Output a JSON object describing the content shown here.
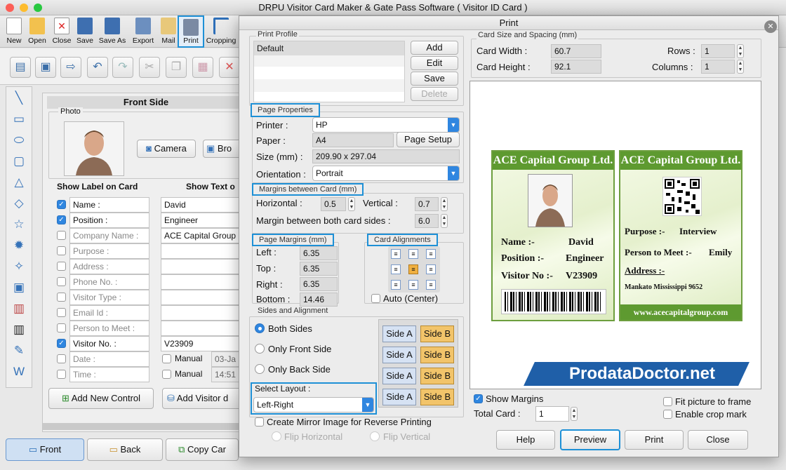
{
  "app": {
    "title": "DRPU Visitor Card Maker & Gate Pass Software ( Visitor ID Card )"
  },
  "toolbar": {
    "items": [
      "New",
      "Open",
      "Close",
      "Save",
      "Save As",
      "Export",
      "Mail",
      "Print",
      "Cropping"
    ]
  },
  "front": {
    "title": "Front Side",
    "photo_label": "Photo",
    "camera": "Camera",
    "browse": "Bro",
    "show_label": "Show Label on Card",
    "show_text": "Show Text o",
    "rows": [
      {
        "label": "Name :",
        "value": "David",
        "checked": true
      },
      {
        "label": "Position :",
        "value": "Engineer",
        "checked": true
      },
      {
        "label": "Company Name :",
        "value": "ACE Capital Group",
        "checked": false
      },
      {
        "label": "Purpose :",
        "value": "",
        "checked": false
      },
      {
        "label": "Address :",
        "value": "",
        "checked": false
      },
      {
        "label": "Phone No. :",
        "value": "",
        "checked": false
      },
      {
        "label": "Visitor Type :",
        "value": "",
        "checked": false
      },
      {
        "label": "Email Id :",
        "value": "",
        "checked": false
      },
      {
        "label": "Person to Meet :",
        "value": "",
        "checked": false
      },
      {
        "label": "Visitor No. :",
        "value": "V23909",
        "checked": true
      },
      {
        "label": "Date :",
        "value": "03-Ja",
        "checked": false,
        "manual": "Manual"
      },
      {
        "label": "Time :",
        "value": "14:51",
        "checked": false,
        "manual": "Manual"
      }
    ],
    "add_control": "Add New Control",
    "add_visitor": "Add Visitor d"
  },
  "bottom": {
    "front": "Front",
    "back": "Back",
    "copy": "Copy Car"
  },
  "dialog": {
    "title": "Print",
    "profile": {
      "legend": "Print Profile",
      "items": [
        "Default"
      ],
      "buttons": [
        "Add",
        "Edit",
        "Save",
        "Delete"
      ]
    },
    "page_props": {
      "legend": "Page Properties",
      "printer_label": "Printer :",
      "printer": "HP",
      "paper_label": "Paper :",
      "paper": "A4",
      "page_setup": "Page Setup",
      "size_label": "Size (mm) :",
      "size": "209.90 x 297.04",
      "orientation_label": "Orientation :",
      "orientation": "Portrait"
    },
    "margins_between": {
      "legend": "Margins between Card (mm)",
      "horizontal_label": "Horizontal :",
      "horizontal": "0.5",
      "vertical_label": "Vertical :",
      "vertical": "0.7",
      "both_label": "Margin between both card sides :",
      "both": "6.0"
    },
    "page_margins": {
      "legend": "Page Margins (mm)",
      "left_label": "Left :",
      "left": "6.35",
      "top_label": "Top :",
      "top": "6.35",
      "right_label": "Right :",
      "right": "6.35",
      "bottom_label": "Bottom :",
      "bottom": "14.46"
    },
    "card_align": {
      "legend": "Card Alignments",
      "auto": "Auto (Center)"
    },
    "sides": {
      "legend": "Sides and Alignment",
      "options": [
        "Both Sides",
        "Only Front Side",
        "Only Back Side"
      ],
      "selected": "Both Sides",
      "layout_label": "Select Layout :",
      "layout": "Left-Right",
      "side_a": "Side A",
      "side_b": "Side B"
    },
    "mirror": {
      "label": "Create Mirror Image for Reverse Printing",
      "flip_h": "Flip Horizontal",
      "flip_v": "Flip Vertical"
    },
    "card_size": {
      "legend": "Card Size and Spacing (mm)",
      "width_label": "Card Width :",
      "width": "60.7",
      "height_label": "Card Height :",
      "height": "92.1",
      "rows_label": "Rows :",
      "rows": "1",
      "cols_label": "Columns :",
      "cols": "1"
    },
    "show_margins": "Show Margins",
    "total_label": "Total Card :",
    "total": "1",
    "fit_picture": "Fit picture to frame",
    "crop_mark": "Enable crop mark",
    "buttons": {
      "help": "Help",
      "preview": "Preview",
      "print": "Print",
      "close": "Close"
    }
  },
  "cards": {
    "front": {
      "company": "ACE Capital Group Ltd.",
      "name_label": "Name :-",
      "name": "David",
      "position_label": "Position :-",
      "position": "Engineer",
      "visitor_label": "Visitor No :-",
      "visitor": "V23909"
    },
    "back": {
      "company": "ACE Capital Group Ltd.",
      "purpose_label": "Purpose :-",
      "purpose": "Interview",
      "meet_label": "Person to Meet :-",
      "meet": "Emily",
      "address_label": "Address :-",
      "address": "Mankato Mississippi 9652",
      "website": "www.acecapitalgroup.com"
    }
  },
  "watermark": "ProdataDoctor.net"
}
